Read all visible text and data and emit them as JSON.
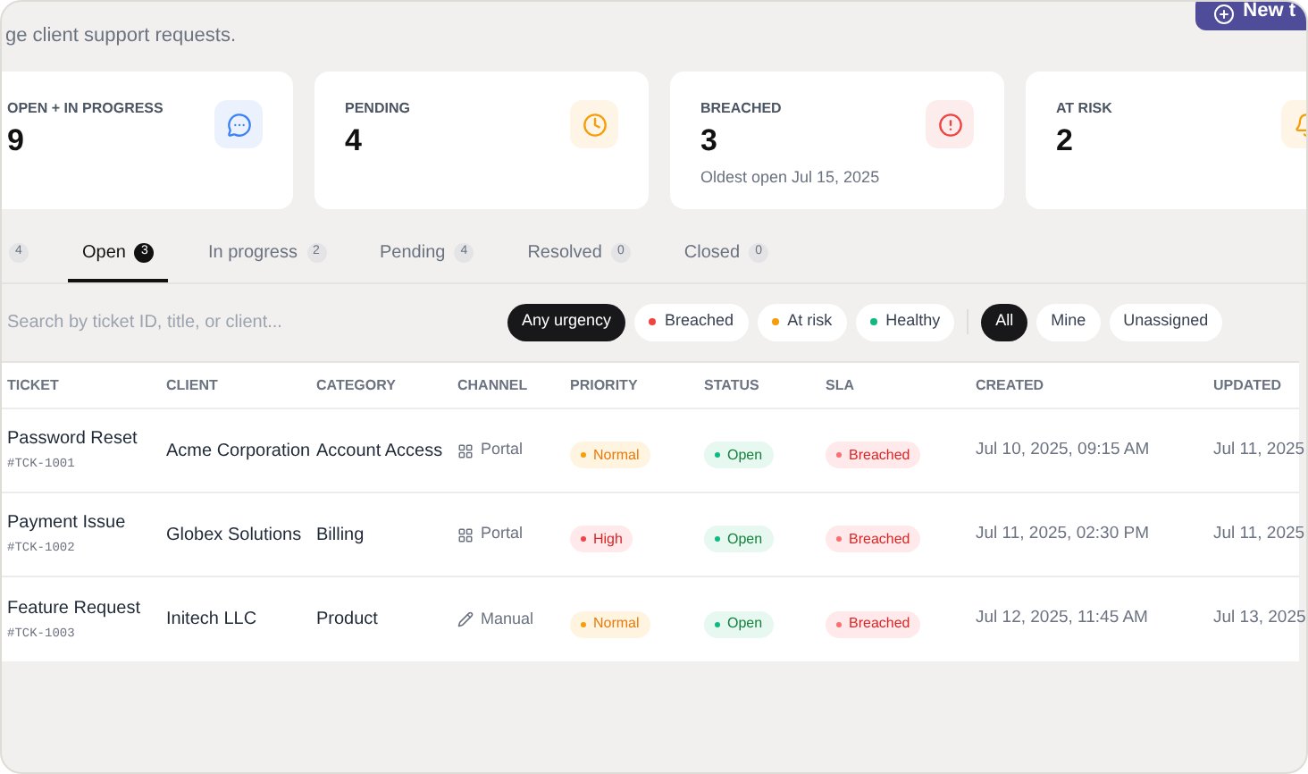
{
  "header": {
    "subtitle": "ge client support requests.",
    "new_button": "New t"
  },
  "stats": [
    {
      "label": "OPEN + IN PROGRESS",
      "value": "9",
      "kind": "chat",
      "color": "#3b82f6"
    },
    {
      "label": "PENDING",
      "value": "4",
      "kind": "clock",
      "color": "#f59e0b"
    },
    {
      "label": "BREACHED",
      "value": "3",
      "note": "Oldest open Jul 15, 2025",
      "kind": "alert",
      "color": "#ef4444"
    },
    {
      "label": "AT RISK",
      "value": "2",
      "kind": "bell",
      "color": "#f59e0b"
    }
  ],
  "tabs": [
    {
      "count": "4",
      "selected": false
    },
    {
      "label": "Open",
      "count": "3",
      "selected": true
    },
    {
      "label": "In progress",
      "count": "2",
      "selected": false
    },
    {
      "label": "Pending",
      "count": "4",
      "selected": false
    },
    {
      "label": "Resolved",
      "count": "0",
      "selected": false
    },
    {
      "label": "Closed",
      "count": "0",
      "selected": false
    }
  ],
  "search": {
    "placeholder": "Search by ticket ID, title, or client..."
  },
  "urgency_filters": [
    {
      "label": "Any urgency",
      "selected": true
    },
    {
      "label": "Breached",
      "selected": false,
      "color": "#ef4444"
    },
    {
      "label": "At risk",
      "selected": false,
      "color": "#f59e0b"
    },
    {
      "label": "Healthy",
      "selected": false,
      "color": "#10b981"
    }
  ],
  "owner_filters": [
    {
      "label": "All",
      "selected": true
    },
    {
      "label": "Mine",
      "selected": false
    },
    {
      "label": "Unassigned",
      "selected": false
    }
  ],
  "table": {
    "columns": [
      "TICKET",
      "CLIENT",
      "CATEGORY",
      "CHANNEL",
      "PRIORITY",
      "STATUS",
      "SLA",
      "CREATED",
      "UPDATED"
    ],
    "rows": [
      {
        "title": "Password Reset",
        "id": "#TCK-1001",
        "client": "Acme Corporation",
        "category": "Account Access",
        "channel": {
          "kind": "portal",
          "label": "Portal"
        },
        "priority": {
          "kind": "normal",
          "label": "Normal"
        },
        "status": "Open",
        "sla": "Breached",
        "created": "Jul 10, 2025, 09:15 AM",
        "updated": "Jul 11, 2025"
      },
      {
        "title": "Payment Issue",
        "id": "#TCK-1002",
        "client": "Globex Solutions",
        "category": "Billing",
        "channel": {
          "kind": "portal",
          "label": "Portal"
        },
        "priority": {
          "kind": "high",
          "label": "High"
        },
        "status": "Open",
        "sla": "Breached",
        "created": "Jul 11, 2025, 02:30 PM",
        "updated": "Jul 11, 2025"
      },
      {
        "title": "Feature Request",
        "id": "#TCK-1003",
        "client": "Initech LLC",
        "category": "Product",
        "channel": {
          "kind": "manual",
          "label": "Manual"
        },
        "priority": {
          "kind": "normal",
          "label": "Normal"
        },
        "status": "Open",
        "sla": "Breached",
        "created": "Jul 12, 2025, 11:45 AM",
        "updated": "Jul 13, 2025"
      }
    ]
  }
}
